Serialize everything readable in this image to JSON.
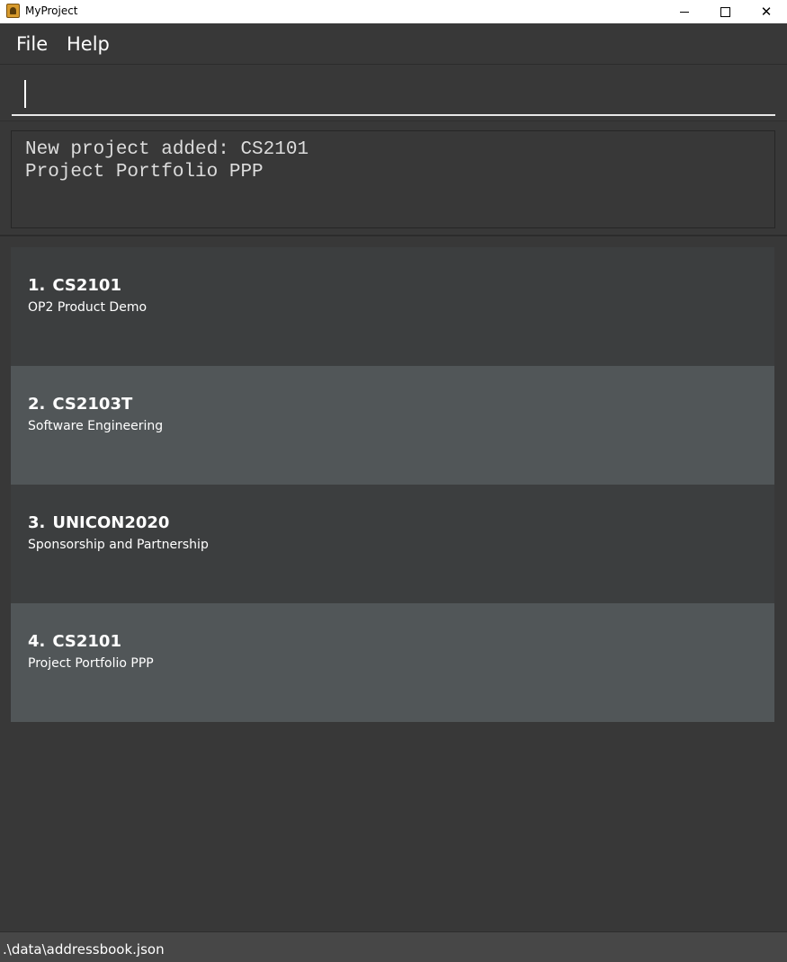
{
  "window": {
    "title": "MyProject",
    "icon": "app-icon",
    "controls": [
      "minimize-icon",
      "maximize-icon",
      "close-icon"
    ],
    "close_glyph": "✕"
  },
  "menu": {
    "file": "File",
    "help": "Help"
  },
  "command": {
    "value": "",
    "placeholder": ""
  },
  "result": {
    "text": "New project added: CS2101\nProject Portfolio PPP"
  },
  "projects": [
    {
      "index": "1.",
      "code": "CS2101",
      "name": "OP2 Product Demo"
    },
    {
      "index": "2.",
      "code": "CS2103T",
      "name": "Software Engineering"
    },
    {
      "index": "3.",
      "code": "UNICON2020",
      "name": "Sponsorship and Partnership"
    },
    {
      "index": "4.",
      "code": "CS2101",
      "name": "Project Portfolio PPP"
    }
  ],
  "status": {
    "path": ".\\data\\addressbook.json"
  },
  "colors": {
    "background": "#383838",
    "card_odd": "#3c3e3f",
    "card_even": "#515658",
    "statusbar": "#474747",
    "titlebar": "#ffffff"
  }
}
